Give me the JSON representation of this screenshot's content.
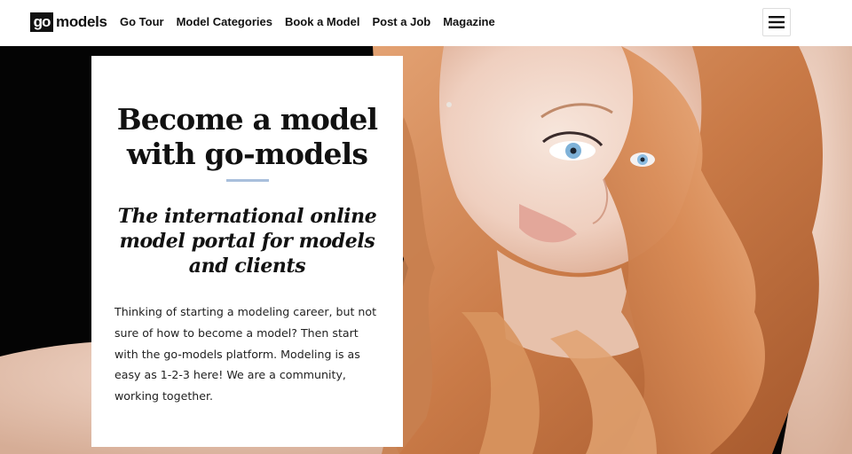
{
  "header": {
    "logo_badge": "go",
    "logo_text": "models",
    "nav": [
      "Go Tour",
      "Model Categories",
      "Book a Model",
      "Post a Job",
      "Magazine"
    ],
    "menu_icon": "hamburger-menu-icon"
  },
  "hero": {
    "title_line1": "Become a model",
    "title_line2": "with go-models",
    "subtitle": "The international online model portal for models and clients",
    "body": "Thinking of starting a modeling career, but not sure of how to become a model? Then start with the go-models platform. Modeling is as easy as 1-2-3 here! We are a community, working together.",
    "accent_color": "#a9bfdc"
  }
}
